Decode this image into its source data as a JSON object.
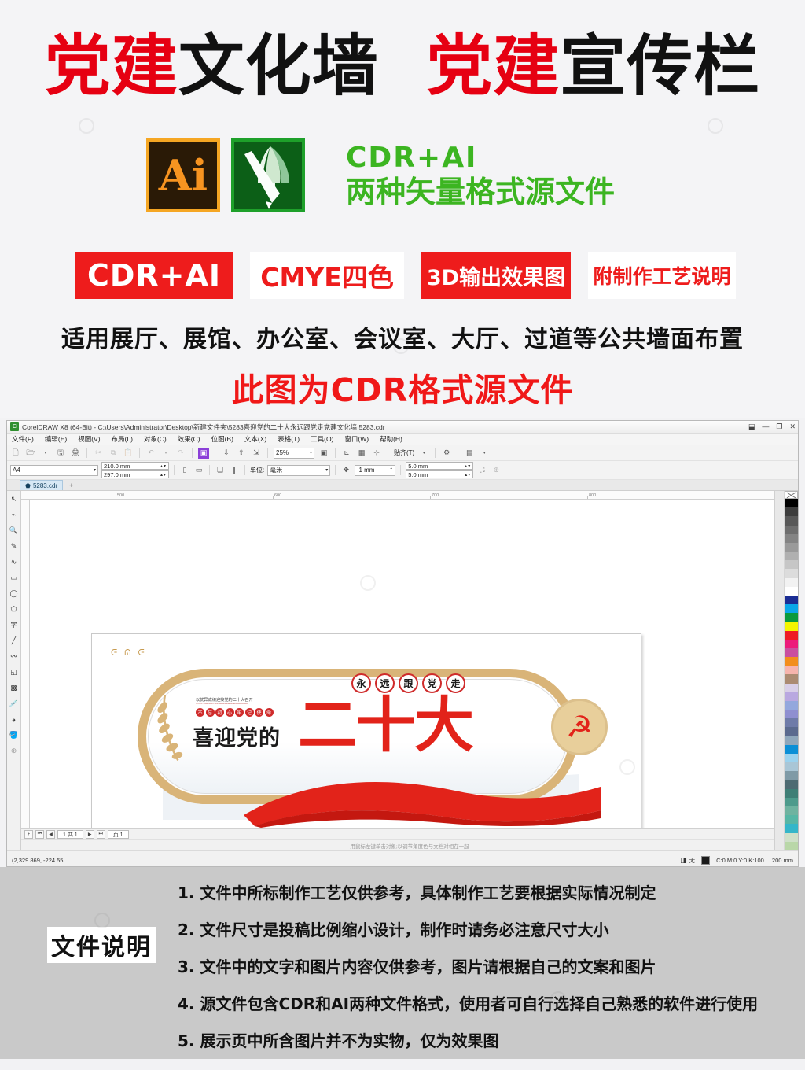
{
  "promo": {
    "title_parts": [
      {
        "text": "党建",
        "color": "red"
      },
      {
        "text": "文化墙",
        "color": "black"
      },
      {
        "text": " ",
        "color": "black"
      },
      {
        "text": "党建",
        "color": "red"
      },
      {
        "text": "宣传栏",
        "color": "black"
      }
    ],
    "title_full": "党建文化墙 党建宣传栏",
    "title_red_1": "党建",
    "title_black_1": "文化墙",
    "title_red_2": "党建",
    "title_black_2": "宣传栏",
    "icons": [
      {
        "name": "illustrator-icon",
        "glyph": "Ai"
      },
      {
        "name": "coreldraw-icon",
        "glyph": ""
      }
    ],
    "format_line1": "CDR+AI",
    "format_line2": "两种矢量格式源文件",
    "format_color": "#3cb521",
    "badges": [
      {
        "label": "CDR+AI",
        "style": "filled"
      },
      {
        "label": "CMYE四色",
        "style": "outline"
      },
      {
        "label": "3D输出效果图",
        "style": "filled"
      },
      {
        "label": "附制作工艺说明",
        "style": "outline"
      }
    ],
    "badge_fill_color": "#ee1c1c",
    "applies_text": "适用展厅、展馆、办公室、会议室、大厅、过道等公共墙面布置",
    "file_format_text": "此图为CDR格式源文件",
    "title_red_color": "#e60012"
  },
  "cdr": {
    "window_title": "CorelDRAW X8 (64-Bit) - C:\\Users\\Administrator\\Desktop\\新建文件夹\\5283喜迎党的二十大永远跟党走党建文化墙 5283.cdr",
    "window_buttons": [
      "restore",
      "minimize",
      "maximize",
      "close"
    ],
    "menu": [
      "文件(F)",
      "编辑(E)",
      "视图(V)",
      "布局(L)",
      "对象(C)",
      "效果(C)",
      "位图(B)",
      "文本(X)",
      "表格(T)",
      "工具(O)",
      "窗口(W)",
      "帮助(H)"
    ],
    "toolbar": {
      "zoom_level": "25%",
      "snap_label": "贴齐(T)",
      "icons": [
        "new-document-icon",
        "open-file-icon",
        "save-icon",
        "print-icon",
        "cut-icon",
        "copy-icon",
        "paste-icon",
        "undo-icon",
        "redo-icon",
        "publish-pdf-icon",
        "import-icon",
        "export-icon",
        "application-launcher-icon",
        "full-screen-preview-icon",
        "show-rulers-icon",
        "show-grid-icon",
        "show-guides-icon",
        "options-gear-icon",
        "view-mode-icon"
      ]
    },
    "property_bar": {
      "page_preset": "A4",
      "page_width": "210.0 mm",
      "page_height": "297.0 mm",
      "unit_label": "单位:",
      "unit_value": "毫米",
      "nudge_value": ".1 mm",
      "duplicate_x": "5.0 mm",
      "duplicate_y": "5.0 mm"
    },
    "document_tab": "5283.cdr",
    "tab_add_label": "+",
    "toolbox": [
      "pick-tool-icon",
      "shape-tool-icon",
      "zoom-tool-icon",
      "freehand-tool-icon",
      "artistic-media-tool-icon",
      "rectangle-tool-icon",
      "ellipse-tool-icon",
      "polygon-tool-icon",
      "text-tool-icon",
      "dimension-tool-icon",
      "connector-tool-icon",
      "drop-shadow-tool-icon",
      "transparency-tool-icon",
      "color-eyedropper-icon",
      "interactive-fill-icon",
      "smart-fill-icon",
      "outline-tool-icon"
    ],
    "ruler_ticks_top": [
      "500",
      "600",
      "700",
      "800"
    ],
    "page_nav": {
      "first": "|◀",
      "prev": "◀",
      "page_indicator": "1 共 1",
      "next": "▶",
      "last": "▶|",
      "add_page": "+",
      "page_tab": "页 1"
    },
    "hint_text": "用鼠标左键单击对象;以调节角度色与文档对相在一起",
    "status": {
      "coordinates": "(2,329.869, -224.55...",
      "outline_cmyk": "C:0 M:0 Y:0 K:100",
      "outline_width": ".200 mm",
      "fill_label": "无"
    },
    "artwork": {
      "top_slogan_chars": [
        "永",
        "远",
        "跟",
        "党",
        "走"
      ],
      "tiny_headline": "以优异成绩迎接党的二十大召开",
      "tiny_pinyin": "YIYOUYICHENGJIYINGJIEDANGDEERSHIDAZHAOKAI",
      "badge_chars": [
        "不",
        "忘",
        "初",
        "心",
        "牢",
        "记",
        "使",
        "命"
      ],
      "main_text_left": "喜迎党的",
      "main_text_big": "二十大",
      "emblem_label": "党徽",
      "main_red": "#e2231a",
      "frame_gold": "#d9b478"
    }
  },
  "notes": {
    "label": "文件说明",
    "items": [
      "1. 文件中所标制作工艺仅供参考，具体制作工艺要根据实际情况制定",
      "2. 文件尺寸是投稿比例缩小设计，制作时请务必注意尺寸大小",
      "3. 文件中的文字和图片内容仅供参考，图片请根据自己的文案和图片",
      "4. 源文件包含CDR和AI两种文件格式，使用者可自行选择自己熟悉的软件进行使用",
      "5. 展示页中所含图片并不为实物，仅为效果图"
    ],
    "background_color": "#c9c9c9"
  }
}
